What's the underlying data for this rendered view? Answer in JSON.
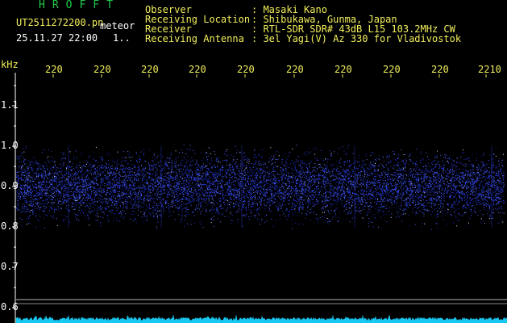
{
  "header": {
    "app_title": "HROFFT",
    "file_name": "UT2511272200.pn",
    "mode": "meteor",
    "datetime": "25.11.27 22:00",
    "counter": "1.."
  },
  "station_info": [
    {
      "key": "Observer",
      "value": ": Masaki Kano"
    },
    {
      "key": "Receiving Location",
      "value": ": Shibukawa, Gunma, Japan"
    },
    {
      "key": "Receiver",
      "value": ": RTL-SDR SDR# 43dB L15 103.2MHz CW"
    },
    {
      "key": "Receiving Antenna",
      "value": ": 3el Yagi(V) Az 330 for Vladivostok"
    }
  ],
  "axes": {
    "unit": "kHz",
    "y_ticks": [
      "1.1",
      "1.0",
      "0.9",
      "0.8",
      "0.7",
      "0.6"
    ],
    "x_ticks": [
      "220",
      "220",
      "220",
      "220",
      "220",
      "220",
      "220",
      "220",
      "220",
      "2210"
    ]
  },
  "colors": {
    "text_green": "#22c84a",
    "text_yellow": "#f2ef5a",
    "text_white": "#ffffff",
    "signal_blue": "#2a3cff",
    "noise_floor_cyan": "#18c8f0"
  }
}
